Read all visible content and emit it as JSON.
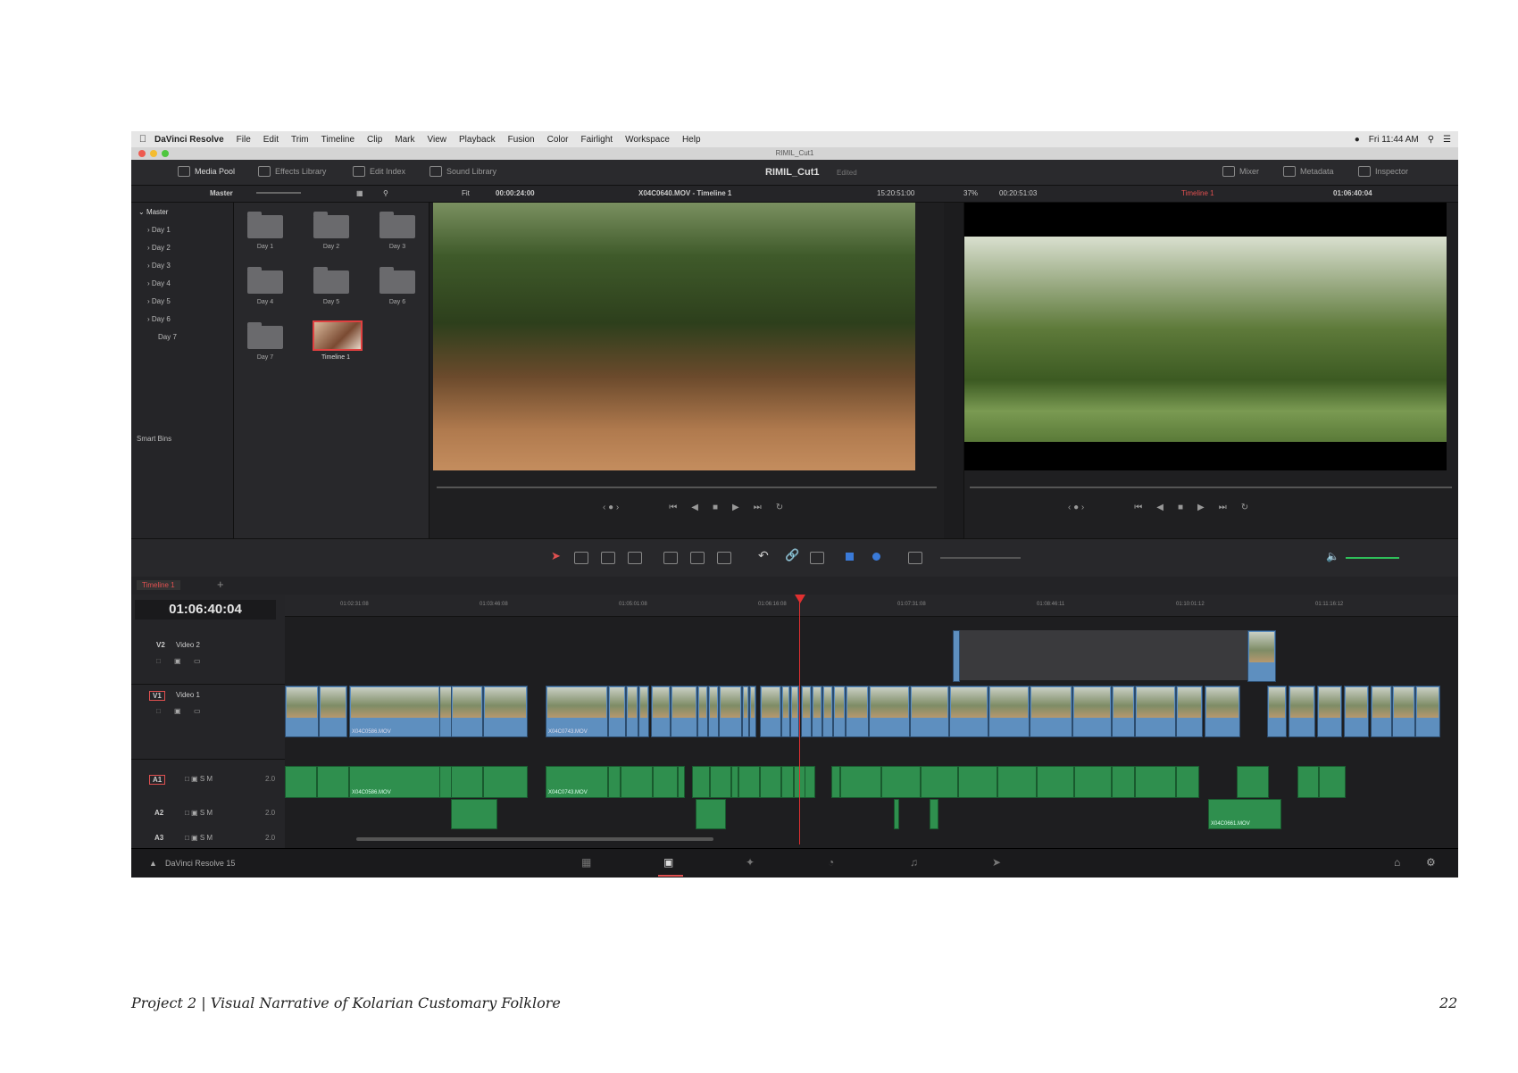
{
  "menubar": {
    "app": "DaVinci Resolve",
    "items": [
      "File",
      "Edit",
      "Trim",
      "Timeline",
      "Clip",
      "Mark",
      "View",
      "Playback",
      "Fusion",
      "Color",
      "Fairlight",
      "Workspace",
      "Help"
    ],
    "clock": "Fri 11:44 AM"
  },
  "window": {
    "title": "RIMIL_Cut1"
  },
  "toolbar": {
    "media_pool": "Media Pool",
    "effects_library": "Effects Library",
    "edit_index": "Edit Index",
    "sound_library": "Sound Library",
    "project": "RIMIL_Cut1",
    "status": "Edited",
    "mixer": "Mixer",
    "metadata": "Metadata",
    "inspector": "Inspector"
  },
  "subbar": {
    "bin": "Master",
    "fit": "Fit",
    "src_duration": "00:00:24:00",
    "src_clip": "X04C0640.MOV - Timeline 1",
    "src_tc": "15:20:51:00",
    "zoom": "37%",
    "rec_duration": "00:20:51:03",
    "rec_timeline": "Timeline 1",
    "rec_tc": "01:06:40:04"
  },
  "bins": {
    "master": "Master",
    "items": [
      "Day 1",
      "Day 2",
      "Day 3",
      "Day 4",
      "Day 5",
      "Day 6",
      "Day 7"
    ],
    "smart_bins": "Smart Bins"
  },
  "pool": {
    "folders": [
      "Day 1",
      "Day 2",
      "Day 3",
      "Day 4",
      "Day 5",
      "Day 6",
      "Day 7"
    ],
    "timeline": "Timeline 1"
  },
  "timeline": {
    "tab": "Timeline 1",
    "timecode": "01:06:40:04",
    "ruler": [
      "01:02:31:08",
      "01:03:46:08",
      "01:05:01:08",
      "01:06:16:08",
      "01:07:31:08",
      "01:08:46:11",
      "01:10:01:12",
      "01:11:16:12"
    ],
    "tracks": {
      "v2": {
        "id": "V2",
        "name": "Video 2"
      },
      "v1": {
        "id": "V1",
        "name": "Video 1"
      },
      "a1": {
        "id": "A1",
        "level": "2.0"
      },
      "a2": {
        "id": "A2",
        "level": "2.0"
      },
      "a3": {
        "id": "A3",
        "level": "2.0"
      }
    },
    "clip_labels": {
      "v1_a": "X04C0586.MOV",
      "v1_b": "X04C0743.MOV",
      "a1_a": "X04C0586.MOV",
      "a1_b": "X04C0743.MOV",
      "a2_end": "X04C0661.MOV"
    }
  },
  "bottombar": {
    "brand": "DaVinci Resolve 15"
  },
  "footer": {
    "caption": "Project 2 | Visual Narrative of Kolarian Customary Folklore",
    "page": "22"
  }
}
